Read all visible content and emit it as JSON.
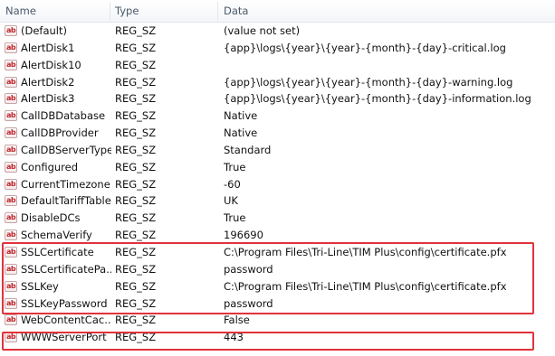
{
  "columns": {
    "name": "Name",
    "type": "Type",
    "data": "Data"
  },
  "value_icon": "ab",
  "highlight_color": "#e2323b",
  "rows": [
    {
      "name": "(Default)",
      "type": "REG_SZ",
      "data": "(value not set)"
    },
    {
      "name": "AlertDisk1",
      "type": "REG_SZ",
      "data": "{app}\\logs\\{year}\\{year}-{month}-{day}-critical.log"
    },
    {
      "name": "AlertDisk10",
      "type": "REG_SZ",
      "data": ""
    },
    {
      "name": "AlertDisk2",
      "type": "REG_SZ",
      "data": "{app}\\logs\\{year}\\{year}-{month}-{day}-warning.log"
    },
    {
      "name": "AlertDisk3",
      "type": "REG_SZ",
      "data": "{app}\\logs\\{year}\\{year}-{month}-{day}-information.log"
    },
    {
      "name": "CallDBDatabase",
      "type": "REG_SZ",
      "data": "Native"
    },
    {
      "name": "CallDBProvider",
      "type": "REG_SZ",
      "data": "Native"
    },
    {
      "name": "CallDBServerType",
      "type": "REG_SZ",
      "data": "Standard"
    },
    {
      "name": "Configured",
      "type": "REG_SZ",
      "data": "True"
    },
    {
      "name": "CurrentTimezone",
      "type": "REG_SZ",
      "data": "-60"
    },
    {
      "name": "DefaultTariffTable",
      "type": "REG_SZ",
      "data": "UK"
    },
    {
      "name": "DisableDCs",
      "type": "REG_SZ",
      "data": "True"
    },
    {
      "name": "SchemaVerify",
      "type": "REG_SZ",
      "data": "196690"
    },
    {
      "name": "SSLCertificate",
      "type": "REG_SZ",
      "data": "C:\\Program Files\\Tri-Line\\TIM Plus\\config\\certificate.pfx"
    },
    {
      "name": "SSLCertificatePa...",
      "type": "REG_SZ",
      "data": "password"
    },
    {
      "name": "SSLKey",
      "type": "REG_SZ",
      "data": "C:\\Program Files\\Tri-Line\\TIM Plus\\config\\certificate.pfx"
    },
    {
      "name": "SSLKeyPassword",
      "type": "REG_SZ",
      "data": "password"
    },
    {
      "name": "WebContentCac...",
      "type": "REG_SZ",
      "data": "False"
    },
    {
      "name": "WWWServerPort",
      "type": "REG_SZ",
      "data": "443"
    }
  ]
}
